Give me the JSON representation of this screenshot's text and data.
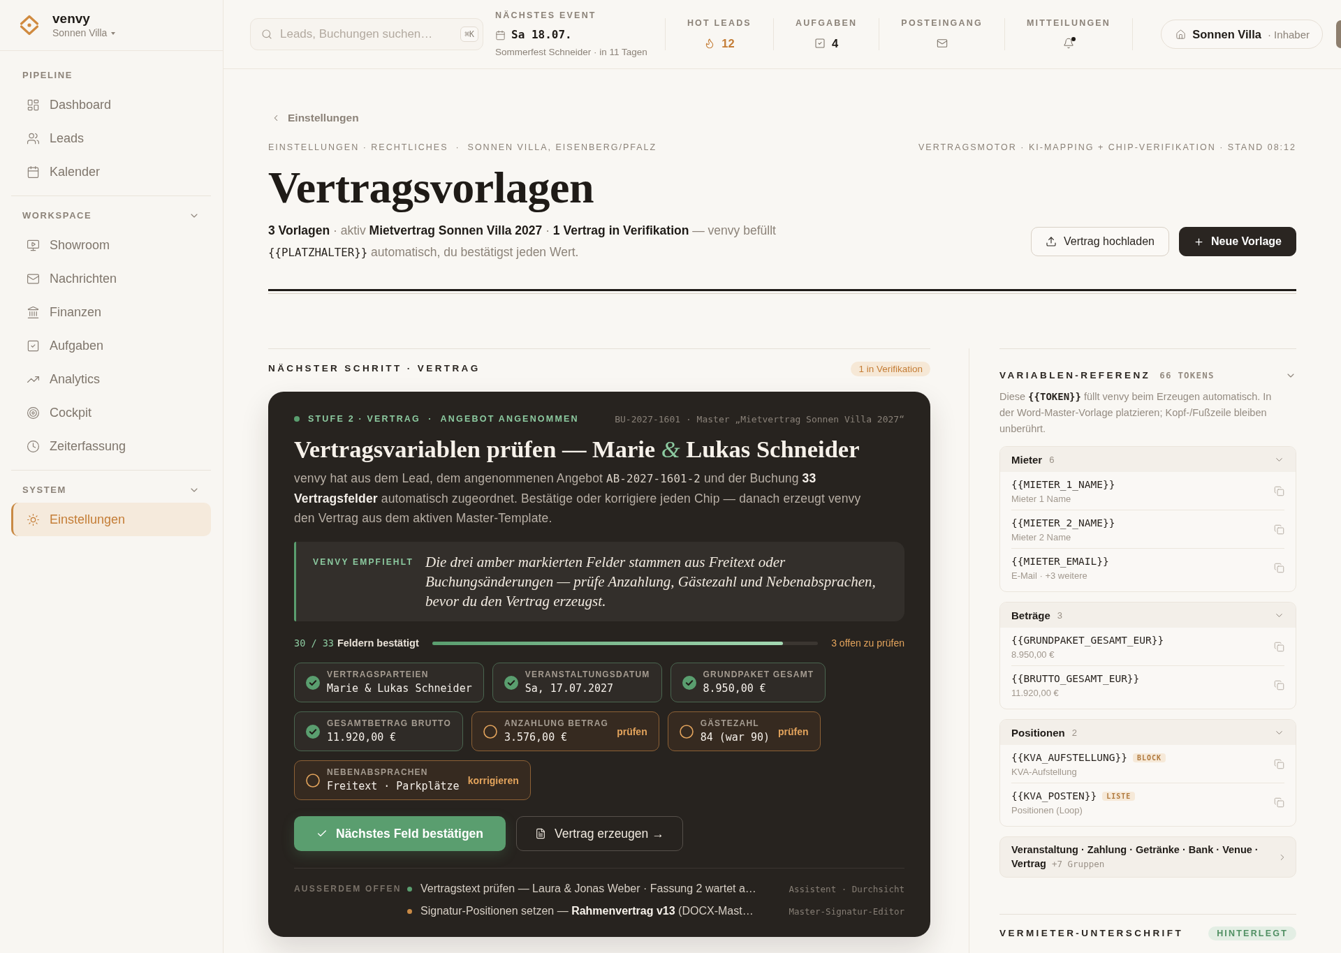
{
  "sidebar": {
    "brand": {
      "name": "venvy",
      "venue": "Sonnen Villa"
    },
    "sections": [
      {
        "title": "PIPELINE",
        "items": [
          {
            "label": "Dashboard",
            "selected": false
          },
          {
            "label": "Leads",
            "selected": false
          },
          {
            "label": "Kalender",
            "selected": false
          }
        ]
      },
      {
        "title": "WORKSPACE",
        "expanded": true,
        "items": [
          {
            "label": "Showroom",
            "selected": false
          },
          {
            "label": "Nachrichten",
            "selected": false
          },
          {
            "label": "Finanzen",
            "selected": false
          },
          {
            "label": "Aufgaben",
            "selected": false
          },
          {
            "label": "Analytics",
            "selected": false
          },
          {
            "label": "Cockpit",
            "selected": false
          },
          {
            "label": "Zeiterfassung",
            "selected": false
          }
        ]
      },
      {
        "title": "SYSTEM",
        "expanded": true,
        "items": [
          {
            "label": "Einstellungen",
            "selected": true
          }
        ]
      }
    ]
  },
  "topbar": {
    "search": {
      "placeholder": "Leads, Buchungen suchen…",
      "shortcut": "⌘K"
    },
    "next_event": {
      "label": "NÄCHSTES EVENT",
      "date": "Sa 18.07.",
      "detail": "Sommerfest Schneider · in 11 Tagen"
    },
    "stats": [
      {
        "kind": "hot",
        "label": "HOT LEADS",
        "value": "12"
      },
      {
        "kind": "tasks",
        "label": "AUFGABEN",
        "value": "4"
      },
      {
        "kind": "inbox",
        "label": "POSTEINGANG"
      },
      {
        "kind": "notifications",
        "label": "MITTEILUNGEN",
        "unread": true
      }
    ],
    "account": {
      "venue": "Sonnen Villa",
      "role": "· Inhaber"
    }
  },
  "header": {
    "back": "Einstellungen",
    "path": "EINSTELLUNGEN · RECHTLICHES  ·  SONNEN VILLA, EISENBERG/PFALZ",
    "engine": "VERTRAGSMOTOR · KI-MAPPING + CHIP-VERIFIKATION · STAND 08:12",
    "title": "Vertragsvorlagen",
    "summary": [
      {
        "kind": "strong",
        "text": "3 Vorlagen"
      },
      {
        "kind": "muted",
        "text": " · aktiv "
      },
      {
        "kind": "strong",
        "text": "Mietvertrag Sonnen Villa 2027"
      },
      {
        "kind": "muted",
        "text": " · "
      },
      {
        "kind": "strong",
        "text": "1 Vertrag in Verifikation"
      },
      {
        "kind": "muted",
        "text": " — venvy befüllt "
      },
      {
        "kind": "code",
        "text": "{{PLATZHALTER}}"
      },
      {
        "kind": "muted",
        "text": " automatisch, du bestätigst jeden Wert."
      }
    ],
    "actions": [
      {
        "kind": "secondary",
        "label": "Vertrag hochladen"
      },
      {
        "kind": "primary",
        "label": "Neue Vorlage"
      }
    ]
  },
  "next_step": {
    "title": "NÄCHSTER SCHRITT · VERTRAG",
    "badge": "1 in Verifikation",
    "card": {
      "stage": "STUFE 2 · VERTRAG  ·  ANGEBOT ANGENOMMEN",
      "reference": "BU-2027-1601 · Master „Mietvertrag Sonnen Villa 2027“",
      "title": "Vertragsvariablen prüfen — Marie *&* Lukas Schneider",
      "description": [
        {
          "kind": "muted",
          "text": "venvy hat aus dem Lead, dem angenommenen Angebot "
        },
        {
          "kind": "code",
          "text": "AB-2027-1601-2"
        },
        {
          "kind": "muted",
          "text": " und der Buchung "
        },
        {
          "kind": "strong",
          "text": "33 Vertragsfelder"
        },
        {
          "kind": "muted",
          "text": " automatisch zugeordnet. Bestätige oder korrigiere jeden Chip — danach erzeugt venvy den Vertrag aus dem aktiven Master-Template."
        }
      ],
      "recommendation": {
        "label": "VENVY EMPFIEHLT",
        "text": "Die drei amber markierten Felder stammen aus Freitext oder Buchungsänderungen — prüfe Anzahlung, Gästezahl und Nebenabsprachen, bevor du den Vertrag erzeugst."
      },
      "progress": {
        "count": "30 / 33",
        "label": "Feldern bestätigt",
        "level": 0.91,
        "open": "3 offen zu prüfen"
      },
      "fields": [
        {
          "label": "VERTRAGSPARTEIEN",
          "value": "Marie & Lukas Schneider",
          "confirmed": true
        },
        {
          "label": "VERANSTALTUNGSDATUM",
          "value": "Sa, 17.07.2027",
          "confirmed": true
        },
        {
          "label": "GRUNDPAKET GESAMT",
          "value": "8.950,00 €",
          "confirmed": true
        },
        {
          "label": "GESAMTBETRAG BRUTTO",
          "value": "11.920,00 €",
          "confirmed": true
        },
        {
          "label": "ANZAHLUNG BETRAG",
          "value": "3.576,00 €",
          "confirmed": false,
          "action": "prüfen"
        },
        {
          "label": "GÄSTEZAHL",
          "value": "84 (war 90)",
          "confirmed": false,
          "action": "prüfen"
        },
        {
          "label": "NEBENABSPRACHEN",
          "value": "Freitext · Parkplätze",
          "confirmed": false,
          "action": "korrigieren"
        }
      ],
      "buttons": [
        {
          "kind": "primary",
          "label": "Nächstes Feld bestätigen"
        },
        {
          "kind": "secondary",
          "label": "Vertrag erzeugen →"
        }
      ],
      "also_open": {
        "label": "AUSSERDEM OFFEN",
        "items": [
          {
            "text": "Vertragstext prüfen — Laura & Jonas Weber · Fassung 2 wartet a…",
            "meta": "Assistent · Durchsicht",
            "color": "#5a9e6f"
          },
          {
            "text": "Signatur-Positionen setzen — **Rahmenvertrag v13** (DOCX-Mast…",
            "meta": "Master-Signatur-Editor",
            "color": "#c98a45"
          }
        ]
      }
    }
  },
  "variables": {
    "title": "VARIABLEN-REFERENZ",
    "count": "66 TOKENS",
    "expanded": true,
    "description": [
      {
        "kind": "muted",
        "text": "Diese "
      },
      {
        "kind": "code",
        "text": "{{TOKEN}}"
      },
      {
        "kind": "muted",
        "text": " füllt venvy beim Erzeugen automatisch. In der Word-Master-Vorlage platzieren; Kopf-/Fußzeile bleiben unberührt."
      }
    ],
    "groups": [
      {
        "name": "Mieter",
        "count": "6",
        "expanded": true,
        "tokens": [
          {
            "token": "{{MIETER_1_NAME}}",
            "hint": "Mieter 1 Name"
          },
          {
            "token": "{{MIETER_2_NAME}}",
            "hint": "Mieter 2 Name"
          },
          {
            "token": "{{MIETER_EMAIL}}",
            "hint": "E-Mail · +3 weitere"
          }
        ]
      },
      {
        "name": "Beträge",
        "count": "3",
        "expanded": true,
        "tokens": [
          {
            "token": "{{GRUNDPAKET_GESAMT_EUR}}",
            "hint": "8.950,00 €"
          },
          {
            "token": "{{BRUTTO_GESAMT_EUR}}",
            "hint": "11.920,00 €"
          }
        ]
      },
      {
        "name": "Positionen",
        "count": "2",
        "expanded": true,
        "tokens": [
          {
            "token": "{{KVA_AUFSTELLUNG}}",
            "tag": "BLOCK",
            "hint": "KVA-Aufstellung"
          },
          {
            "token": "{{KVA_POSTEN}}",
            "tag": "LISTE",
            "hint": "Positionen (Loop)"
          }
        ]
      }
    ],
    "more": {
      "groups": "Veranstaltung · Zahlung · Getränke · Bank · Venue · Vertrag",
      "count": "+7 Gruppen"
    }
  },
  "signature": {
    "title": "VERMIETER-UNTERSCHRIFT",
    "badge": "HINTERLEGT"
  }
}
